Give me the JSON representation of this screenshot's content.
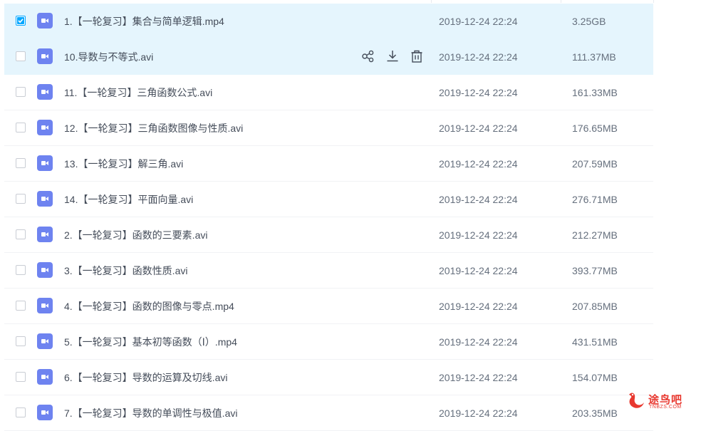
{
  "files": [
    {
      "name": "1.【一轮复习】集合与简单逻辑.mp4",
      "date": "2019-12-24 22:24",
      "size": "3.25GB",
      "checked": true,
      "hover": false
    },
    {
      "name": "10.导数与不等式.avi",
      "date": "2019-12-24 22:24",
      "size": "111.37MB",
      "checked": false,
      "hover": true
    },
    {
      "name": "11.【一轮复习】三角函数公式.avi",
      "date": "2019-12-24 22:24",
      "size": "161.33MB",
      "checked": false,
      "hover": false
    },
    {
      "name": "12.【一轮复习】三角函数图像与性质.avi",
      "date": "2019-12-24 22:24",
      "size": "176.65MB",
      "checked": false,
      "hover": false
    },
    {
      "name": "13.【一轮复习】解三角.avi",
      "date": "2019-12-24 22:24",
      "size": "207.59MB",
      "checked": false,
      "hover": false
    },
    {
      "name": "14.【一轮复习】平面向量.avi",
      "date": "2019-12-24 22:24",
      "size": "276.71MB",
      "checked": false,
      "hover": false
    },
    {
      "name": "2.【一轮复习】函数的三要素.avi",
      "date": "2019-12-24 22:24",
      "size": "212.27MB",
      "checked": false,
      "hover": false
    },
    {
      "name": "3.【一轮复习】函数性质.avi",
      "date": "2019-12-24 22:24",
      "size": "393.77MB",
      "checked": false,
      "hover": false
    },
    {
      "name": "4.【一轮复习】函数的图像与零点.mp4",
      "date": "2019-12-24 22:24",
      "size": "207.85MB",
      "checked": false,
      "hover": false
    },
    {
      "name": "5.【一轮复习】基本初等函数（Ⅰ）.mp4",
      "date": "2019-12-24 22:24",
      "size": "431.51MB",
      "checked": false,
      "hover": false
    },
    {
      "name": "6.【一轮复习】导数的运算及切线.avi",
      "date": "2019-12-24 22:24",
      "size": "154.07MB",
      "checked": false,
      "hover": false
    },
    {
      "name": "7.【一轮复习】导数的单调性与极值.avi",
      "date": "2019-12-24 22:24",
      "size": "203.35MB",
      "checked": false,
      "hover": false
    }
  ],
  "row_actions": {
    "share_icon": "share-icon",
    "download_icon": "download-icon",
    "delete_icon": "trash-icon"
  },
  "watermark": {
    "text": "途鸟吧",
    "sub": "TNBZS.COM"
  },
  "colors": {
    "selected_bg": "#e5f5fd",
    "accent": "#06a7ff",
    "video_icon": "#6e83f0"
  }
}
